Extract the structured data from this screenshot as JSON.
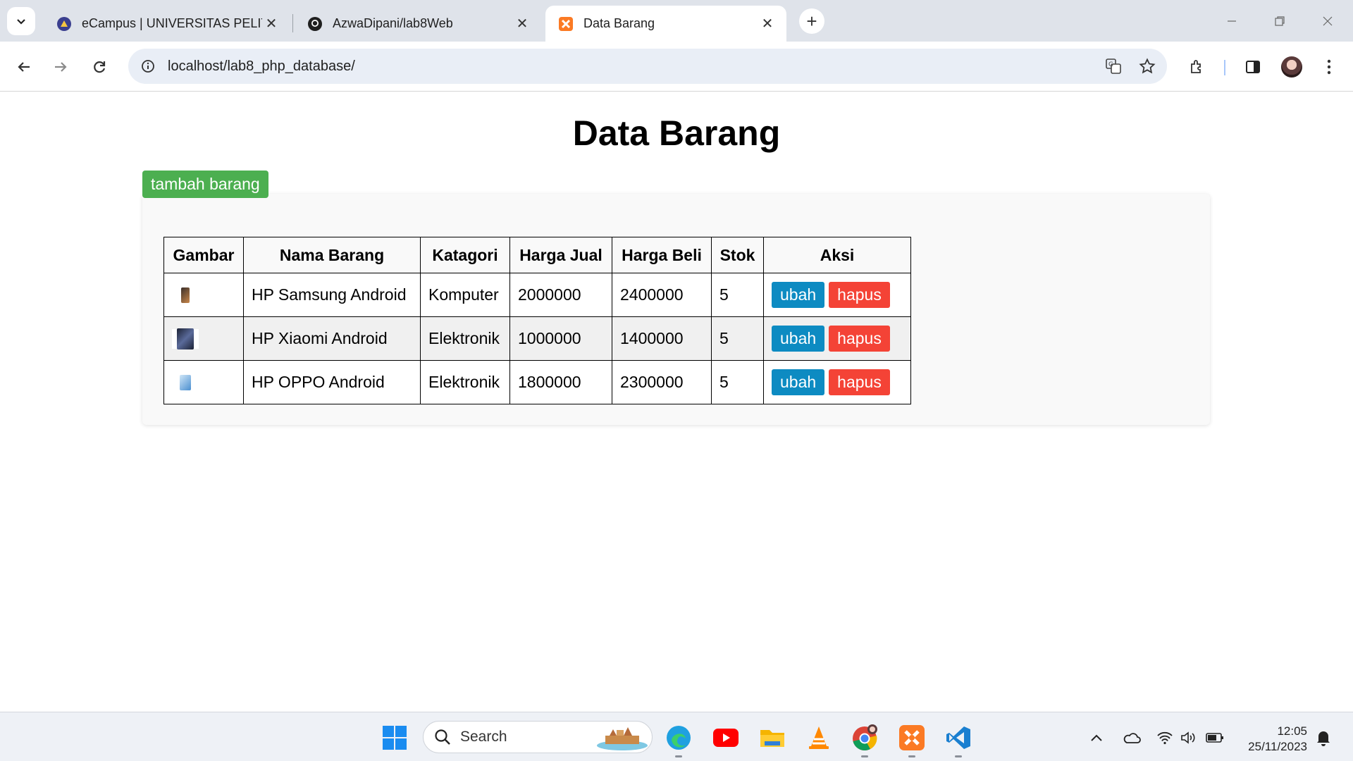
{
  "browser": {
    "tabs": [
      {
        "title": "eCampus | UNIVERSITAS PELIT",
        "icon": "university-logo-icon"
      },
      {
        "title": "AzwaDipani/lab8Web",
        "icon": "github-icon"
      },
      {
        "title": "Data Barang",
        "icon": "xampp-icon",
        "active": true
      }
    ],
    "url": "localhost/lab8_php_database/"
  },
  "page": {
    "title": "Data Barang",
    "add_button": "tambah barang",
    "table": {
      "headers": [
        "Gambar",
        "Nama Barang",
        "Katagori",
        "Harga Jual",
        "Harga Beli",
        "Stok",
        "Aksi"
      ],
      "rows": [
        {
          "image": "phone-image-samsung",
          "nama": "HP Samsung Android",
          "kategori": "Komputer",
          "harga_jual": "2000000",
          "harga_beli": "2400000",
          "stok": "5",
          "edit": "ubah",
          "delete": "hapus"
        },
        {
          "image": "phone-image-xiaomi",
          "nama": "HP Xiaomi Android",
          "kategori": "Elektronik",
          "harga_jual": "1000000",
          "harga_beli": "1400000",
          "stok": "5",
          "edit": "ubah",
          "delete": "hapus"
        },
        {
          "image": "phone-image-oppo",
          "nama": "HP OPPO Android",
          "kategori": "Elektronik",
          "harga_jual": "1800000",
          "harga_beli": "2300000",
          "stok": "5",
          "edit": "ubah",
          "delete": "hapus"
        }
      ]
    },
    "colors": {
      "add": "#4caf50",
      "edit": "#0d8bc2",
      "delete": "#f44336"
    }
  },
  "taskbar": {
    "search_label": "Search",
    "time": "12:05",
    "date": "25/11/2023"
  }
}
